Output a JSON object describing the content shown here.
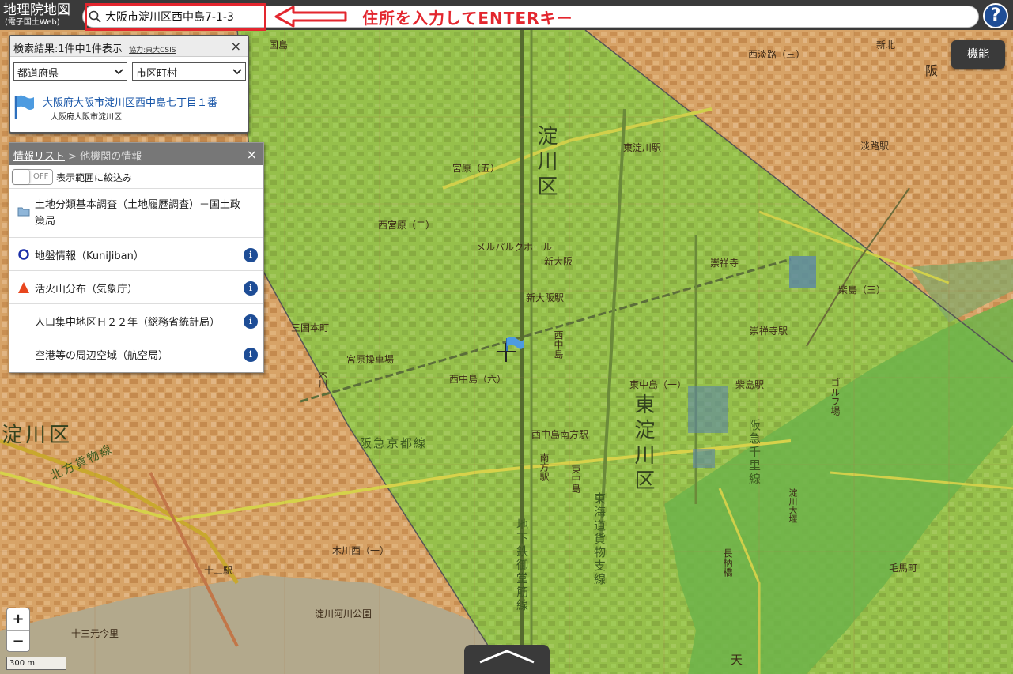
{
  "header": {
    "logo_title": "地理院地図",
    "logo_subtitle": "(電子国土Web)",
    "search_value": "大阪市淀川区西中島7-1-3",
    "annotation": "住所を入力してENTERキー",
    "help_label": "?"
  },
  "function_button": "機能",
  "search_panel": {
    "title": "検索結果:1件中1件表示",
    "credit": "協力:東大CSIS",
    "close": "×",
    "prefecture_select": "都道府県",
    "city_select": "市区町村",
    "result_title": "大阪府大阪市淀川区西中島七丁目１番",
    "result_subtitle": "大阪府大阪市淀川区"
  },
  "info_panel": {
    "title_link": "情報リスト",
    "title_sep": " > ",
    "title_rest": "他機関の情報",
    "close": "×",
    "toggle_state": "OFF",
    "filter_label": "表示範囲に絞込み",
    "folder_item": "土地分類基本調査（土地履歴調査）－国土政策局",
    "items": [
      "地盤情報（KuniJiban）",
      "活火山分布（気象庁）",
      "人口集中地区Ｈ２２年（総務省統計局）",
      "空港等の周辺空域（航空局）"
    ],
    "info_glyph": "i"
  },
  "zoom": {
    "in": "+",
    "out": "−"
  },
  "scale": "300 m",
  "map_labels": {
    "yodogawa_ku_center": "淀川区",
    "higashi_yodogawa_ku": "東淀川区",
    "yodogawa_ku_left": "淀川区",
    "hankyu_kyoto_line": "阪急京都線",
    "hokuhou_line": "北方貨物線",
    "tokaido_line": "東海道貨物支線",
    "midosuji_line": "地下鉄御堂筋線",
    "hankyu_senri": "阪急千里線",
    "shin_osaka": "新大阪駅",
    "higashi_yodogawa_st": "東淀川駅",
    "sozenji_st": "崇禅寺駅",
    "shibajima_st": "柴島駅",
    "nishinakajima_st": "西中島南方駅",
    "minamikata_st": "南方駅",
    "miyahara_yard": "宮原操車場",
    "nishimiyahara": "西宮原（二）",
    "miyahara5": "宮原（五）",
    "awaji": "淡路駅",
    "nishiawaji": "西淡路（三）",
    "nishinakajima6": "西中島（六）",
    "juso": "十三駅",
    "kizugawa": "木川西（一）",
    "yodogawa_park": "淀川河川公園",
    "golf": "ゴルフ場",
    "hanten": "阪",
    "shinkita": "新北",
    "nishinakajima": "西中島",
    "mikuni_honmachi": "三国本町",
    "higashinakajima": "東中島（一）",
    "higashinakajima2": "東中島",
    "naganobashi": "長柄橋",
    "kunijima": "国島",
    "tenma": "天",
    "kesa": "毛馬町",
    "sozenji": "崇禅寺",
    "shibashima3": "柴島（三）",
    "yodo_river": "淀川大堰",
    "shin_osaka_hotel": "新大阪",
    "mellparc": "メルパルクホール",
    "juso_honmachi": "十三元今里",
    "kizu": "木川"
  }
}
